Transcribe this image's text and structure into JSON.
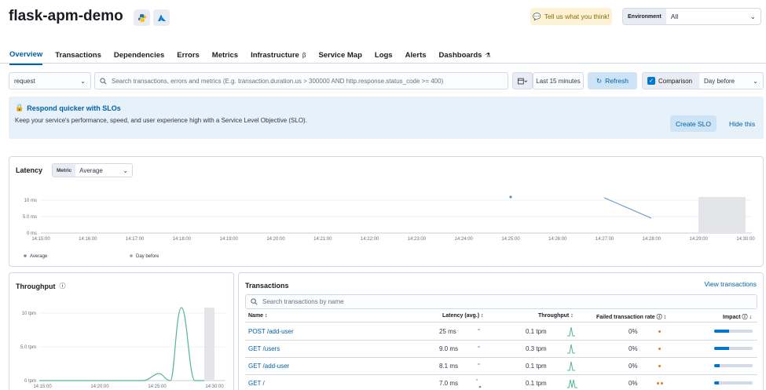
{
  "header": {
    "title": "flask-apm-demo",
    "feedback_label": "Tell us what you think!",
    "environment_label": "Environment",
    "environment_value": "All"
  },
  "tabs": [
    {
      "label": "Overview",
      "active": true
    },
    {
      "label": "Transactions"
    },
    {
      "label": "Dependencies"
    },
    {
      "label": "Errors"
    },
    {
      "label": "Metrics"
    },
    {
      "label": "Infrastructure",
      "badge": "β"
    },
    {
      "label": "Service Map"
    },
    {
      "label": "Logs"
    },
    {
      "label": "Alerts"
    },
    {
      "label": "Dashboards",
      "badge": "⚗"
    }
  ],
  "filters": {
    "transaction_type": "request",
    "search_placeholder": "Search transactions, errors and metrics (E.g. transaction.duration.us > 300000 AND http.response.status_code >= 400)",
    "date_range": "Last 15 minutes",
    "refresh_label": "Refresh",
    "comparison_label": "Comparison",
    "comparison_value": "Day before"
  },
  "callout": {
    "title": "Respond quicker with SLOs",
    "text": "Keep your service's performance, speed, and user experience high with a Service Level Objective (SLO).",
    "create_label": "Create SLO",
    "hide_label": "Hide this"
  },
  "latency": {
    "title": "Latency",
    "metric_label": "Metric",
    "metric_value": "Average",
    "y_ticks": [
      "10 ms",
      "5.0 ms",
      "0 ms"
    ],
    "x_ticks": [
      "14:15:00",
      "14:16:00",
      "14:17:00",
      "14:18:00",
      "14:19:00",
      "14:20:00",
      "14:21:00",
      "14:22:00",
      "14:23:00",
      "14:24:00",
      "14:25:00",
      "14:26:00",
      "14:27:00",
      "14:28:00",
      "14:29:00",
      "14:30:00"
    ],
    "legend": [
      "Average",
      "Day before"
    ]
  },
  "throughput": {
    "title": "Throughput",
    "y_ticks": [
      "10 tpm",
      "5.0 tpm",
      "0 tpm"
    ],
    "x_ticks": [
      "14:15:00",
      "14:20:00",
      "14:25:00",
      "14:30:00"
    ]
  },
  "transactions": {
    "title": "Transactions",
    "view_label": "View transactions",
    "search_placeholder": "Search transactions by name",
    "columns": [
      "Name",
      "Latency (avg.)",
      "Throughput",
      "Failed transaction rate",
      "Impact"
    ],
    "rows": [
      {
        "name": "POST /add-user",
        "latency": "25 ms",
        "throughput": "0.1 tpm",
        "failed": "0%",
        "impact": 0.38
      },
      {
        "name": "GET /users",
        "latency": "9.0 ms",
        "throughput": "0.3 tpm",
        "failed": "0%",
        "impact": 0.38
      },
      {
        "name": "GET /add-user",
        "latency": "8.1 ms",
        "throughput": "0.1 tpm",
        "failed": "0%",
        "impact": 0.14
      },
      {
        "name": "GET /",
        "latency": "7.0 ms",
        "throughput": "0.1 tpm",
        "failed": "0%",
        "impact": 0.12
      }
    ]
  },
  "colors": {
    "primary": "#0077cc",
    "link": "#0061a6",
    "series_latency": "#6092c0",
    "series_throughput": "#54b399"
  }
}
